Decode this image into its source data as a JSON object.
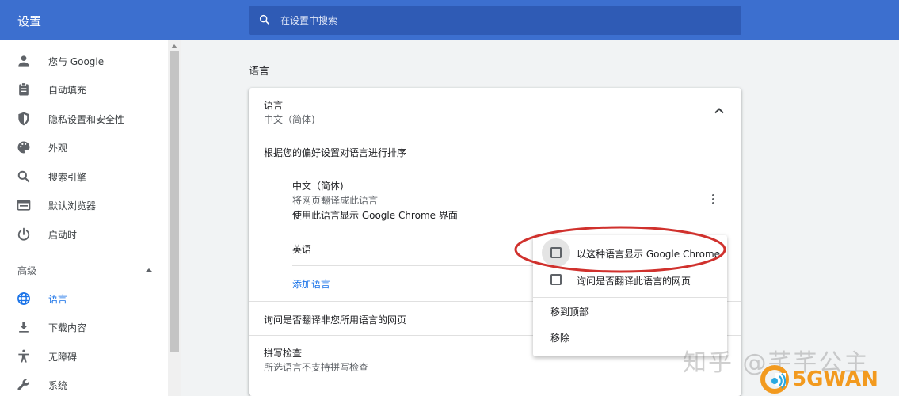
{
  "header": {
    "app_title": "设置",
    "search_placeholder": "在设置中搜索"
  },
  "sidebar": {
    "items": [
      {
        "label": "您与 Google",
        "icon": "person-icon"
      },
      {
        "label": "自动填充",
        "icon": "clipboard-icon"
      },
      {
        "label": "隐私设置和安全性",
        "icon": "shield-icon"
      },
      {
        "label": "外观",
        "icon": "palette-icon"
      },
      {
        "label": "搜索引擎",
        "icon": "search-icon"
      },
      {
        "label": "默认浏览器",
        "icon": "browser-icon"
      },
      {
        "label": "启动时",
        "icon": "power-icon"
      }
    ],
    "advanced_label": "高级",
    "advanced_items": [
      {
        "label": "语言",
        "icon": "globe-icon",
        "active": true
      },
      {
        "label": "下载内容",
        "icon": "download-icon"
      },
      {
        "label": "无障碍",
        "icon": "accessibility-icon"
      },
      {
        "label": "系统",
        "icon": "wrench-icon"
      }
    ]
  },
  "main": {
    "section_title": "语言",
    "language_card": {
      "title": "语言",
      "current": "中文（简体)",
      "order_description": "根据您的偏好设置对语言进行排序",
      "entries": [
        {
          "name": "中文（简体)",
          "line1": "将网页翻译成此语言",
          "line2": "使用此语言显示 Google Chrome 界面"
        },
        {
          "name": "英语"
        }
      ],
      "add_language": "添加语言",
      "ask_translate": "询问是否翻译非您所用语言的网页",
      "spellcheck_title": "拼写检查",
      "spellcheck_sub": "所选语言不支持拼写检查"
    }
  },
  "context_menu": {
    "items": [
      {
        "label": "以这种语言显示 Google Chrome",
        "checked": false
      },
      {
        "label": "询问是否翻译此语言的网页",
        "checked": false
      }
    ],
    "move_top": "移到顶部",
    "remove": "移除"
  },
  "annotation": {
    "color": "#d0312d"
  },
  "watermark": {
    "text": "知乎 @芊芊公主",
    "brand": "5GWAN"
  },
  "colors": {
    "header": "#3c6fcf",
    "accent": "#1a73e8"
  }
}
